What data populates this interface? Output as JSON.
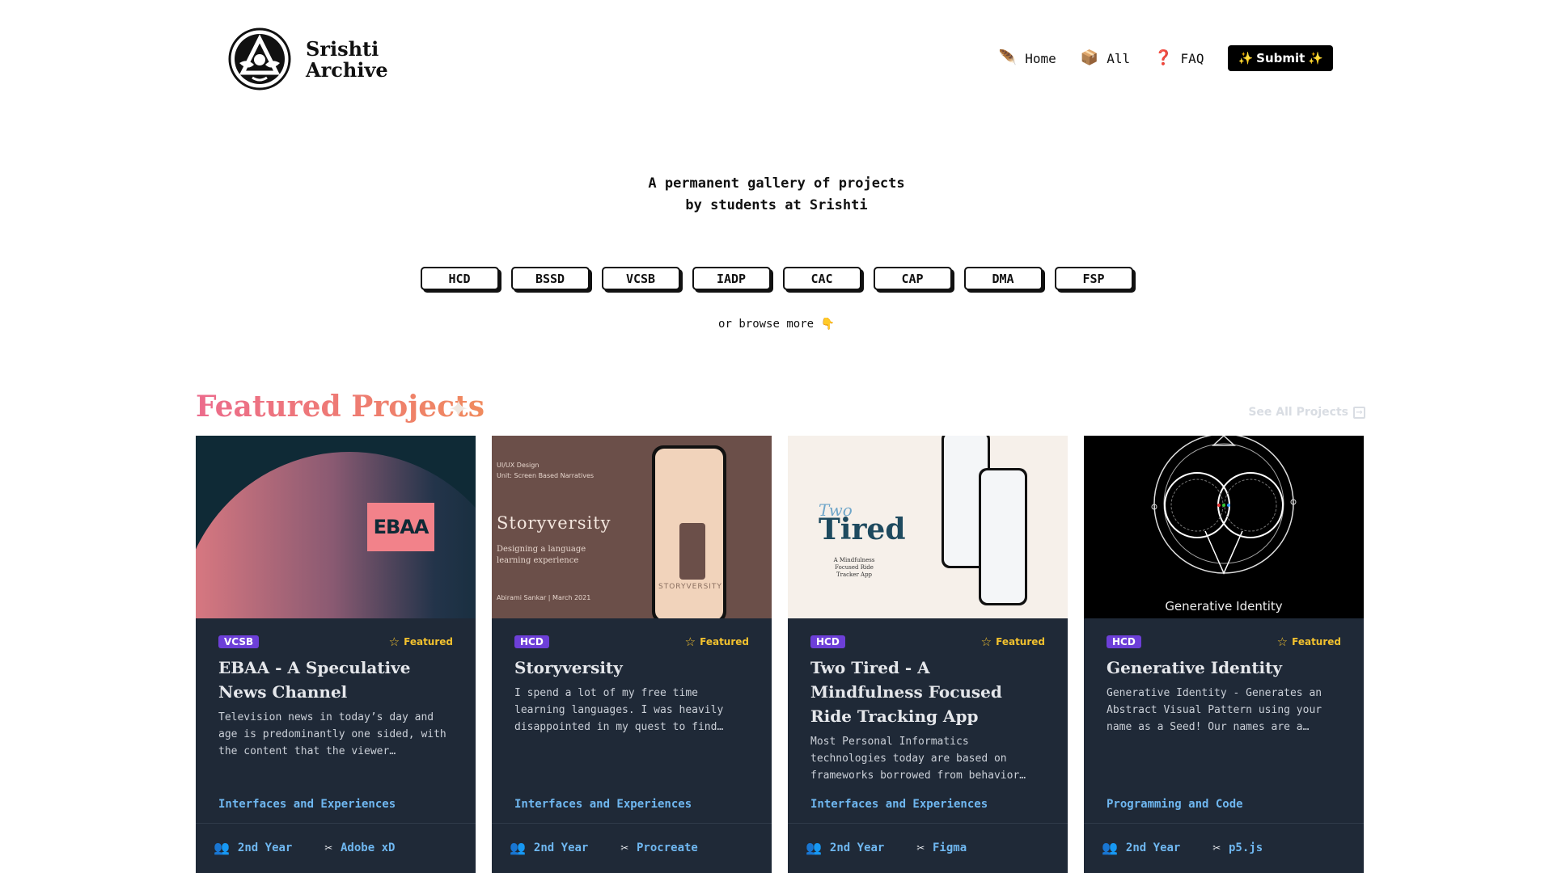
{
  "brand": {
    "line1": "Srishti",
    "line2": "Archive"
  },
  "nav": {
    "items": [
      {
        "label": "Home",
        "icon": "🪶"
      },
      {
        "label": "All",
        "icon": "📦"
      },
      {
        "label": "FAQ",
        "icon": "❓"
      }
    ],
    "submit_label": "Submit"
  },
  "hero": {
    "tagline_line1": "A permanent gallery of projects",
    "tagline_line2": "by students at Srishti",
    "chips": [
      "HCD",
      "BSSD",
      "VCSB",
      "IADP",
      "CAC",
      "CAP",
      "DMA",
      "FSP"
    ],
    "browse_label": "or browse more"
  },
  "featured": {
    "title": "Featured Projects",
    "see_all": "See All Projects",
    "featured_label": "Featured",
    "cards": [
      {
        "badge": "VCSB",
        "title": "EBAA - A Speculative News Channel",
        "desc": "Television news in today’s day and age is predominantly one sided, with the content that the viewer…",
        "category": "Interfaces and Experiences",
        "year": "2nd Year",
        "tool": "Adobe xD",
        "thumb": {
          "logo": "EBAA"
        }
      },
      {
        "badge": "HCD",
        "title": "Storyversity",
        "desc": "I spend a lot of my free time learning languages. I was heavily disappointed in my quest to find…",
        "category": "Interfaces and Experiences",
        "year": "2nd Year",
        "tool": "Procreate",
        "thumb": {
          "line1": "UI/UX Design",
          "line2": "Unit: Screen Based Narratives",
          "title": "Storyversity",
          "sub": "Designing a language learning experience",
          "author": "Abirami Sankar | March 2021",
          "screen": "STORYVERSITY"
        }
      },
      {
        "badge": "HCD",
        "title": "Two Tired - A Mindfulness Focused Ride Tracking App",
        "desc": "Most Personal Informatics technologies today are based on frameworks borrowed from behavior…",
        "category": "Interfaces and Experiences",
        "year": "2nd Year",
        "tool": "Figma",
        "thumb": {
          "two": "Two",
          "tired": "Tired",
          "cap": "A Mindfulness Focused Ride Tracker App"
        }
      },
      {
        "badge": "HCD",
        "title": "Generative Identity",
        "desc": "Generative Identity - Generates an Abstract Visual Pattern using your name as a Seed! Our names are a…",
        "category": "Programming and Code",
        "year": "2nd Year",
        "tool": "p5.js",
        "thumb": {
          "caption": "Generative Identity"
        }
      }
    ]
  }
}
